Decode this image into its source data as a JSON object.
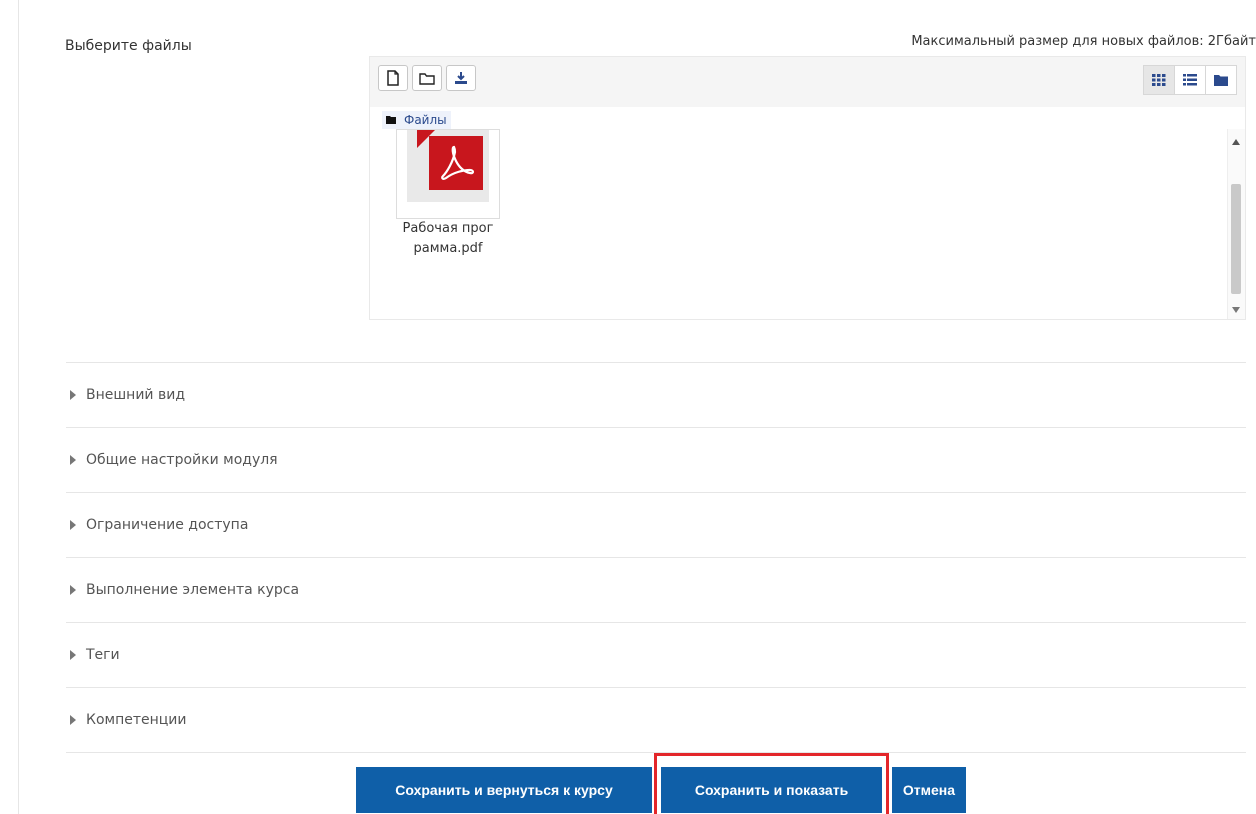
{
  "form": {
    "field_label": "Выберите файлы",
    "max_size": "Максимальный размер для новых файлов: 2Гбайт"
  },
  "filepicker": {
    "toolbar": {
      "add_icon": "file-add-icon",
      "create_folder_icon": "folder-icon",
      "download_icon": "download-icon"
    },
    "views": [
      "grid-view-icon",
      "list-view-icon",
      "tree-view-icon"
    ],
    "active_view": "grid-view-icon",
    "path": "Файлы",
    "files": [
      {
        "name": "Рабочая программа.pdf",
        "type_icon": "pdf-icon"
      }
    ]
  },
  "sections": [
    {
      "label": "Внешний вид"
    },
    {
      "label": "Общие настройки модуля"
    },
    {
      "label": "Ограничение доступа"
    },
    {
      "label": "Выполнение элемента курса"
    },
    {
      "label": "Теги"
    },
    {
      "label": "Компетенции"
    }
  ],
  "buttons": {
    "save_return": "Сохранить и вернуться к курсу",
    "save_show": "Сохранить и показать",
    "cancel": "Отмена"
  },
  "colors": {
    "primary_button": "#0f5fa8",
    "highlight": "#e3262a",
    "pdf_red": "#c8161d"
  }
}
